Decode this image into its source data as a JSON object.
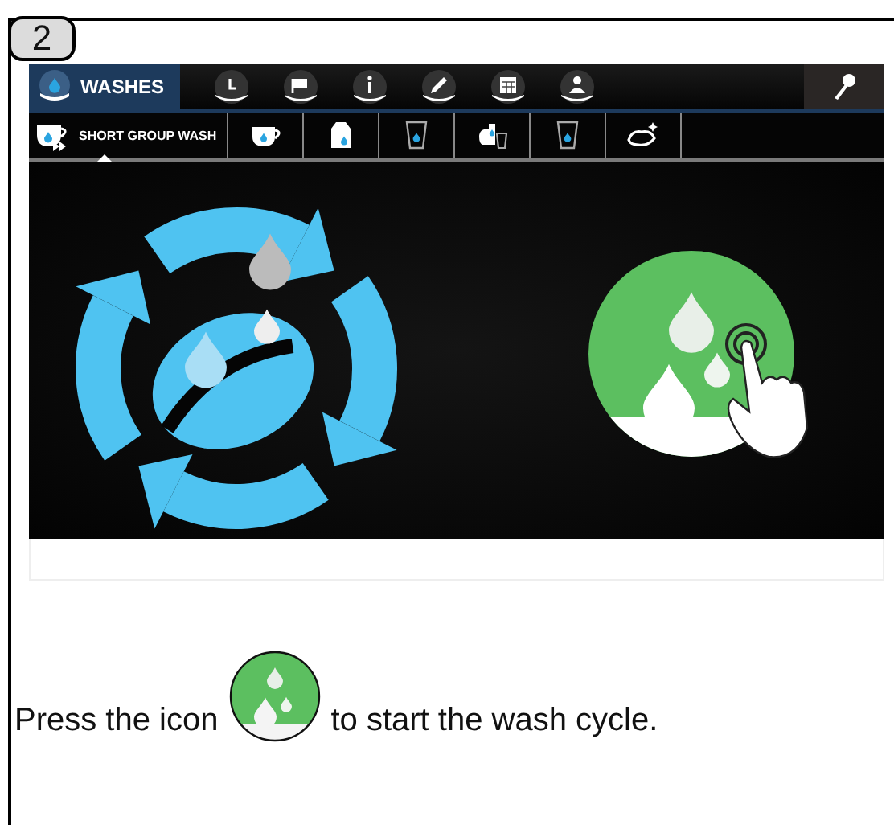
{
  "step": "2",
  "screen": {
    "top_tabs": [
      {
        "label": "WASHES",
        "selected": true
      },
      {
        "selected": false
      },
      {
        "selected": false
      },
      {
        "selected": false
      },
      {
        "selected": false
      },
      {
        "selected": false
      },
      {
        "selected": false
      }
    ],
    "wash_tabs": [
      {
        "label": "SHORT GROUP WASH",
        "selected": true
      },
      {
        "selected": false
      },
      {
        "selected": false
      },
      {
        "selected": false
      },
      {
        "selected": false
      },
      {
        "selected": false
      },
      {
        "selected": false
      }
    ]
  },
  "instruction": {
    "before": "Press the icon",
    "after": "to start the wash cycle."
  }
}
